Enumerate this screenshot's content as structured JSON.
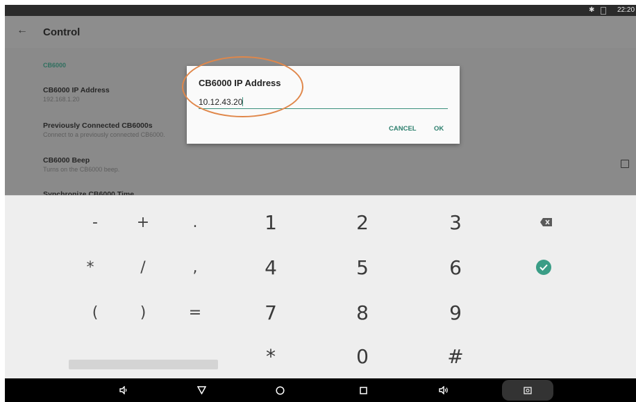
{
  "status_bar": {
    "time": "22:20",
    "icons": [
      "bluetooth-icon",
      "no-sim-icon"
    ]
  },
  "app_bar": {
    "title": "Control",
    "back_icon": "arrow-left-icon"
  },
  "preferences": {
    "section": "CB6000",
    "items": [
      {
        "title": "CB6000 IP Address",
        "summary": "192.168.1.20"
      },
      {
        "title": "Previously Connected CB6000s",
        "summary": "Connect to a previously connected CB6000."
      },
      {
        "title": "CB6000 Beep",
        "summary": "Turns on the CB6000 beep.",
        "checked": false
      },
      {
        "title": "Synchronize CB6000 Time",
        "summary": ""
      }
    ]
  },
  "dialog": {
    "title": "CB6000 IP Address",
    "value": "10.12.43.20",
    "cancel_label": "CANCEL",
    "ok_label": "OK"
  },
  "keyboard": {
    "row1": [
      "-",
      "+",
      ".",
      "1",
      "2",
      "3"
    ],
    "row2": [
      "*",
      "/",
      ",",
      "4",
      "5",
      "6"
    ],
    "row3": [
      "(",
      ")",
      "=",
      "7",
      "8",
      "9"
    ],
    "row4": [
      "*",
      "0",
      "#"
    ],
    "icons": [
      "backspace-icon",
      "done-check-icon"
    ]
  },
  "nav_bar": {
    "icons": [
      "volume-down-icon",
      "back-triangle-icon",
      "home-circle-icon",
      "recents-square-icon",
      "volume-up-icon",
      "screenshot-icon"
    ]
  },
  "colors": {
    "accent": "#3a8f7b",
    "highlight_ring": "#e0874a",
    "dim_overlay": "#8a8a8a"
  }
}
